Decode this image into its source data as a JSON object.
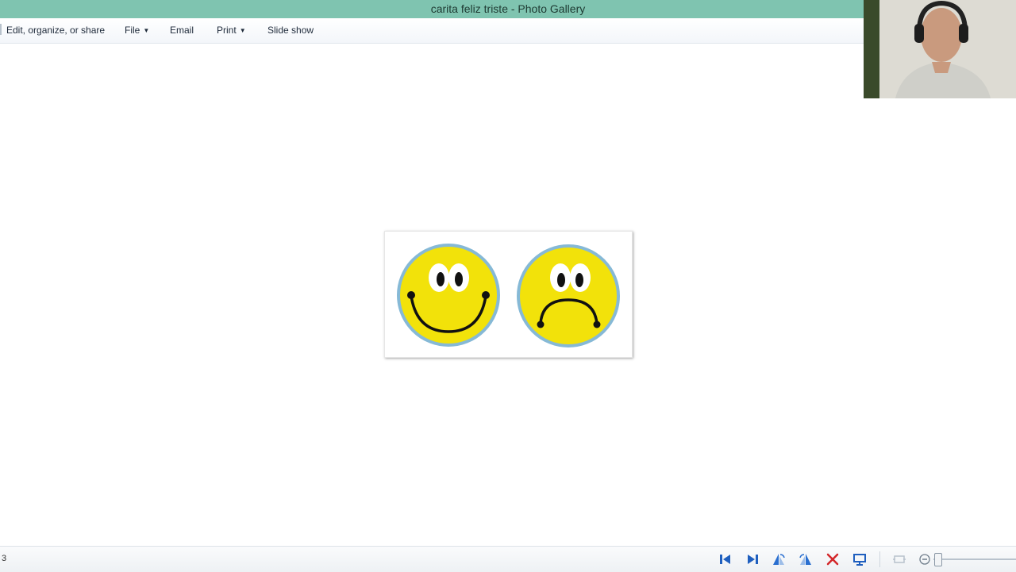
{
  "window": {
    "title": "carita feliz triste - Photo Gallery"
  },
  "menubar": {
    "items": [
      {
        "label": "Edit, organize, or share",
        "has_caret": false
      },
      {
        "label": "File",
        "has_caret": true
      },
      {
        "label": "Email",
        "has_caret": false
      },
      {
        "label": "Print",
        "has_caret": true
      },
      {
        "label": "Slide show",
        "has_caret": false
      }
    ]
  },
  "statusbar": {
    "item_count": "3",
    "nav_icons": [
      "previous-icon",
      "next-icon",
      "rotate-left-icon",
      "rotate-right-icon",
      "delete-icon",
      "slideshow-display-icon",
      "actual-size-icon",
      "zoom-out-icon"
    ]
  },
  "colors": {
    "titlebar": "#7fc4b0",
    "smiley_fill": "#f2e20a",
    "smiley_border": "#86b9d6",
    "nav_blue": "#1f5fbf",
    "delete_red": "#d3272a"
  }
}
